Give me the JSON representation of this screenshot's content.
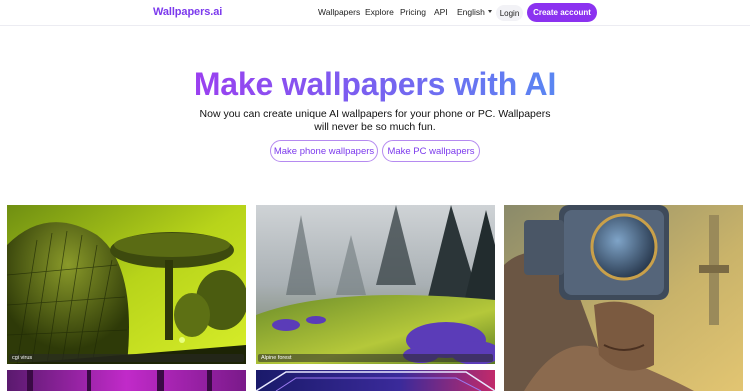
{
  "header": {
    "logo": "Wallpapers.ai",
    "nav": [
      "Wallpapers",
      "Explore",
      "Pricing",
      "API"
    ],
    "language": "English",
    "login_label": "Login",
    "create_account_label": "Create account"
  },
  "hero": {
    "title": "Make wallpapers with AI",
    "subtitle": "Now you can create unique AI wallpapers for your phone or PC. Wallpapers will never be so much fun.",
    "phone_button": "Make phone wallpapers",
    "pc_button": "Make PC wallpapers"
  },
  "gallery": [
    {
      "caption": "cgi virus"
    },
    {
      "caption": "Alpine forest"
    },
    {
      "caption": ""
    },
    {
      "caption": ""
    },
    {
      "caption": ""
    }
  ],
  "colors": {
    "brand": "#7c3aed",
    "cta": "#8b32f0"
  }
}
